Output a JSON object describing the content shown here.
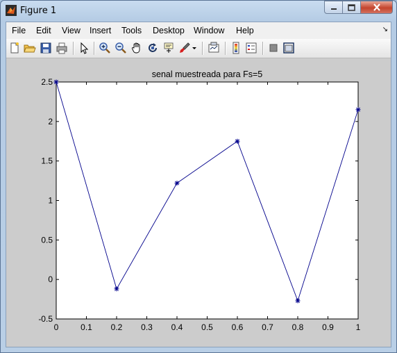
{
  "window": {
    "title": "Figure 1"
  },
  "menu": {
    "items": [
      "File",
      "Edit",
      "View",
      "Insert",
      "Tools",
      "Desktop",
      "Window",
      "Help"
    ]
  },
  "toolbar": {
    "icons": [
      "new-figure-icon",
      "open-file-icon",
      "save-icon",
      "print-icon",
      "edit-plot-arrow-icon",
      "zoom-in-icon",
      "zoom-out-icon",
      "pan-hand-icon",
      "rotate-3d-icon",
      "data-cursor-icon",
      "brush-icon",
      "brush-dropdown-icon",
      "link-plot-icon",
      "insert-colorbar-icon",
      "insert-legend-icon",
      "hide-plot-tools-icon",
      "show-plot-tools-icon"
    ]
  },
  "chart_data": {
    "type": "line",
    "title": "senal muestreada para Fs=5",
    "xlabel": "",
    "ylabel": "",
    "x": [
      0,
      0.2,
      0.4,
      0.6,
      0.8,
      1.0
    ],
    "series": [
      {
        "values": [
          2.5,
          -0.12,
          1.22,
          1.75,
          -0.27,
          2.15
        ]
      }
    ],
    "xlim": [
      0,
      1
    ],
    "ylim": [
      -0.5,
      2.5
    ],
    "xticks": [
      "0",
      "0.1",
      "0.2",
      "0.3",
      "0.4",
      "0.5",
      "0.6",
      "0.7",
      "0.8",
      "0.9",
      "1"
    ],
    "yticks": [
      "-0.5",
      "0",
      "0.5",
      "1",
      "1.5",
      "2",
      "2.5"
    ],
    "marker": "*",
    "line_color": "#00008b",
    "grid": false
  }
}
